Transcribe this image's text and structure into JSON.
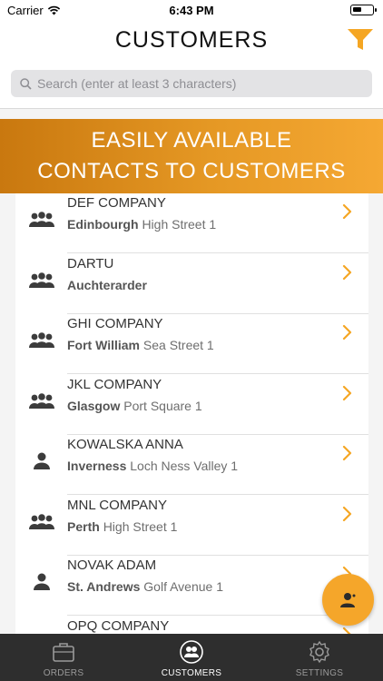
{
  "status_bar": {
    "carrier": "Carrier",
    "time": "6:43 PM"
  },
  "header": {
    "title": "CUSTOMERS",
    "filter_icon": "filter-icon",
    "accent_color": "#f5a623"
  },
  "search": {
    "placeholder": "Search (enter at least 3 characters)"
  },
  "banner": {
    "line1": "EASILY AVAILABLE",
    "line2": "CONTACTS TO CUSTOMERS"
  },
  "customers": [
    {
      "name": "DEF COMPANY",
      "city": "Edinbourgh",
      "street": "High Street 1",
      "type": "company"
    },
    {
      "name": "DARTU",
      "city": "Auchterarder",
      "street": "",
      "type": "company"
    },
    {
      "name": "GHI COMPANY",
      "city": "Fort William",
      "street": "Sea Street 1",
      "type": "company"
    },
    {
      "name": "JKL COMPANY",
      "city": "Glasgow",
      "street": "Port Square 1",
      "type": "company"
    },
    {
      "name": "KOWALSKA ANNA",
      "city": "Inverness",
      "street": "Loch Ness Valley 1",
      "type": "person"
    },
    {
      "name": "MNL COMPANY",
      "city": "Perth",
      "street": "High Street 1",
      "type": "company"
    },
    {
      "name": "NOVAK ADAM",
      "city": "St. Andrews",
      "street": "Golf Avenue 1",
      "type": "person"
    },
    {
      "name": "OPQ COMPANY",
      "city": "",
      "street": "",
      "type": "company"
    }
  ],
  "tabs": [
    {
      "label": "ORDERS",
      "icon": "briefcase-icon",
      "active": false
    },
    {
      "label": "CUSTOMERS",
      "icon": "customers-icon",
      "active": true
    },
    {
      "label": "SETTINGS",
      "icon": "gear-icon",
      "active": false
    }
  ]
}
